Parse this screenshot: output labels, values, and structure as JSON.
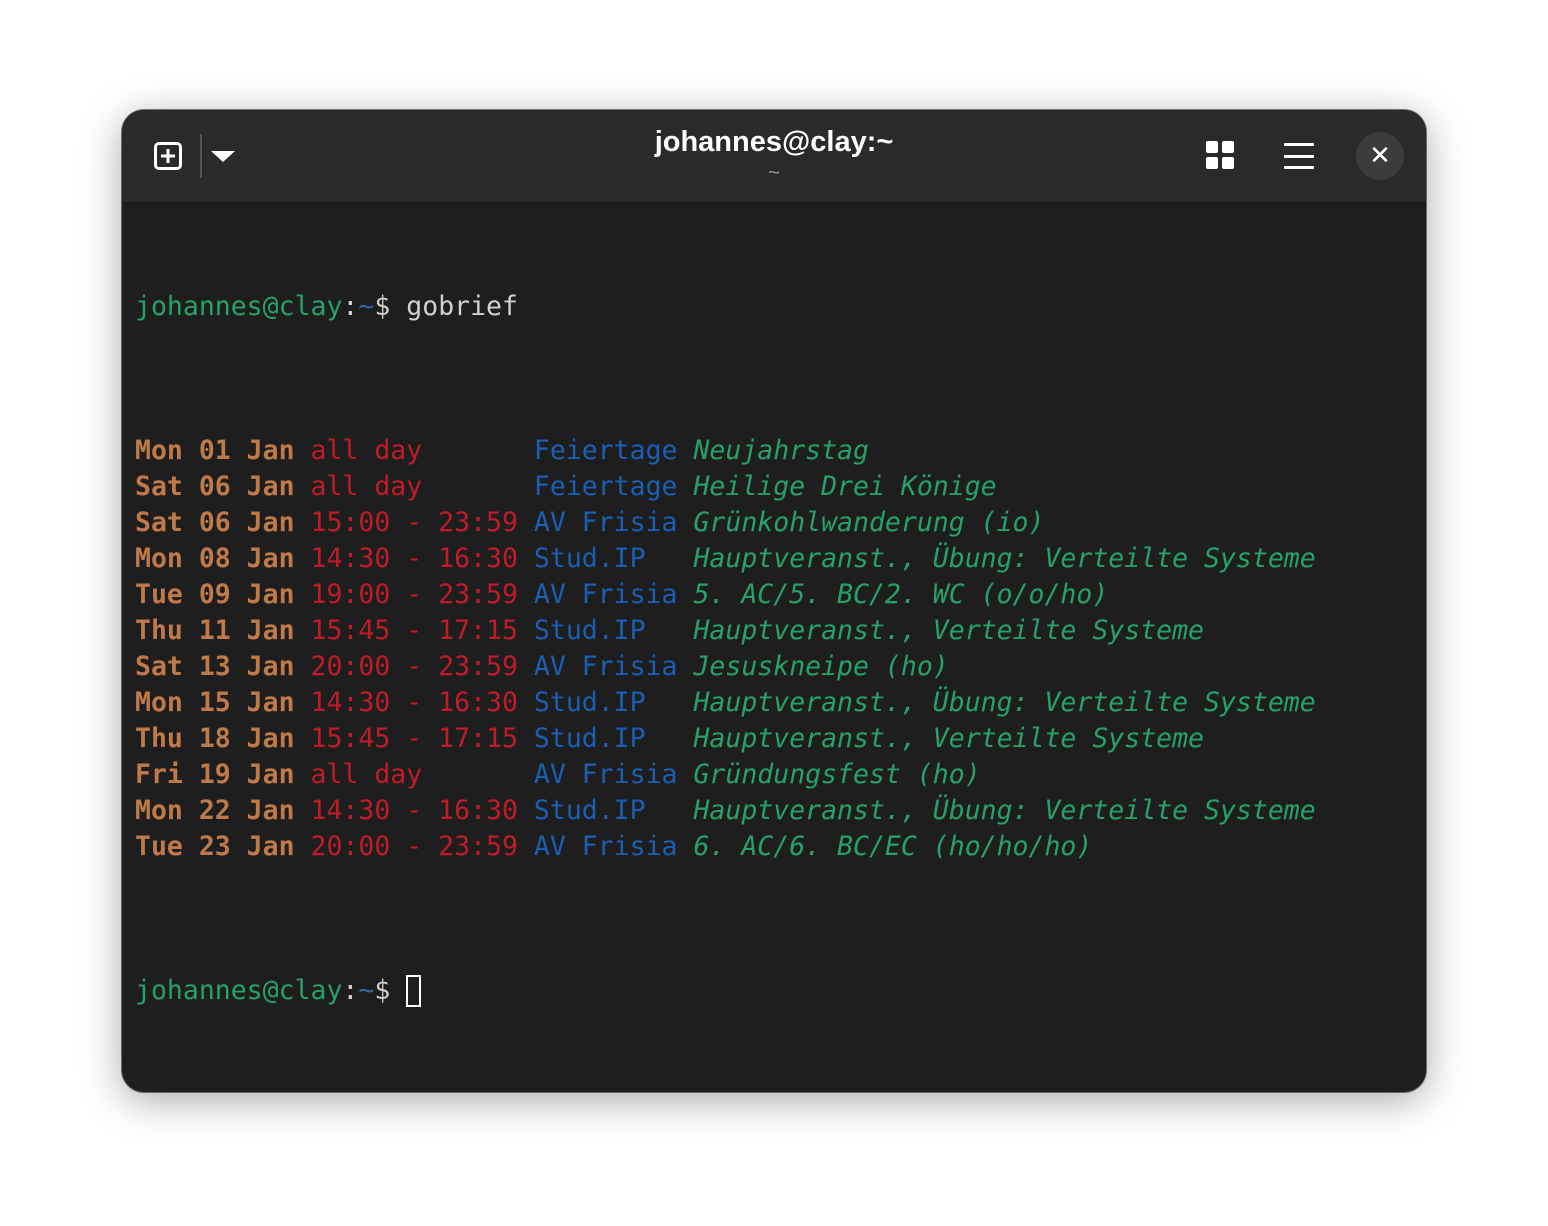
{
  "window": {
    "title": "johannes@clay:~",
    "subtitle": "~"
  },
  "header": {
    "new_tab_icon": "new-tab-plus-icon",
    "dropdown_icon": "chevron-down-icon",
    "grid_icon": "tab-overview-icon",
    "menu_icon": "hamburger-menu-icon",
    "close_glyph": "✕"
  },
  "prompt": {
    "user_host": "johannes@clay",
    "colon": ":",
    "path": "~",
    "symbol": "$ ",
    "command": "gobrief"
  },
  "rows": [
    {
      "date": "Mon 01 Jan",
      "time": "all day      ",
      "calendar": "Feiertage",
      "summary": "Neujahrstag"
    },
    {
      "date": "Sat 06 Jan",
      "time": "all day      ",
      "calendar": "Feiertage",
      "summary": "Heilige Drei Könige"
    },
    {
      "date": "Sat 06 Jan",
      "time": "15:00 - 23:59",
      "calendar": "AV Frisia",
      "summary": "Grünkohlwanderung (io)"
    },
    {
      "date": "Mon 08 Jan",
      "time": "14:30 - 16:30",
      "calendar": "Stud.IP  ",
      "summary": "Hauptveranst., Übung: Verteilte Systeme"
    },
    {
      "date": "Tue 09 Jan",
      "time": "19:00 - 23:59",
      "calendar": "AV Frisia",
      "summary": "5. AC/5. BC/2. WC (o/o/ho)"
    },
    {
      "date": "Thu 11 Jan",
      "time": "15:45 - 17:15",
      "calendar": "Stud.IP  ",
      "summary": "Hauptveranst., Verteilte Systeme"
    },
    {
      "date": "Sat 13 Jan",
      "time": "20:00 - 23:59",
      "calendar": "AV Frisia",
      "summary": "Jesuskneipe (ho)"
    },
    {
      "date": "Mon 15 Jan",
      "time": "14:30 - 16:30",
      "calendar": "Stud.IP  ",
      "summary": "Hauptveranst., Übung: Verteilte Systeme"
    },
    {
      "date": "Thu 18 Jan",
      "time": "15:45 - 17:15",
      "calendar": "Stud.IP  ",
      "summary": "Hauptveranst., Verteilte Systeme"
    },
    {
      "date": "Fri 19 Jan",
      "time": "all day      ",
      "calendar": "AV Frisia",
      "summary": "Gründungsfest (ho)"
    },
    {
      "date": "Mon 22 Jan",
      "time": "14:30 - 16:30",
      "calendar": "Stud.IP  ",
      "summary": "Hauptveranst., Übung: Verteilte Systeme"
    },
    {
      "date": "Tue 23 Jan",
      "time": "20:00 - 23:59",
      "calendar": "AV Frisia",
      "summary": "6. AC/6. BC/EC (ho/ho/ho)"
    }
  ],
  "colors": {
    "prompt_user": "#26a269",
    "prompt_path": "#3465a4",
    "date": "#c07a4a",
    "time": "#c01c28",
    "calendar": "#1a5fb4",
    "summary": "#26a269",
    "background": "#1e1e1e",
    "headerbar": "#2a2a2a"
  }
}
